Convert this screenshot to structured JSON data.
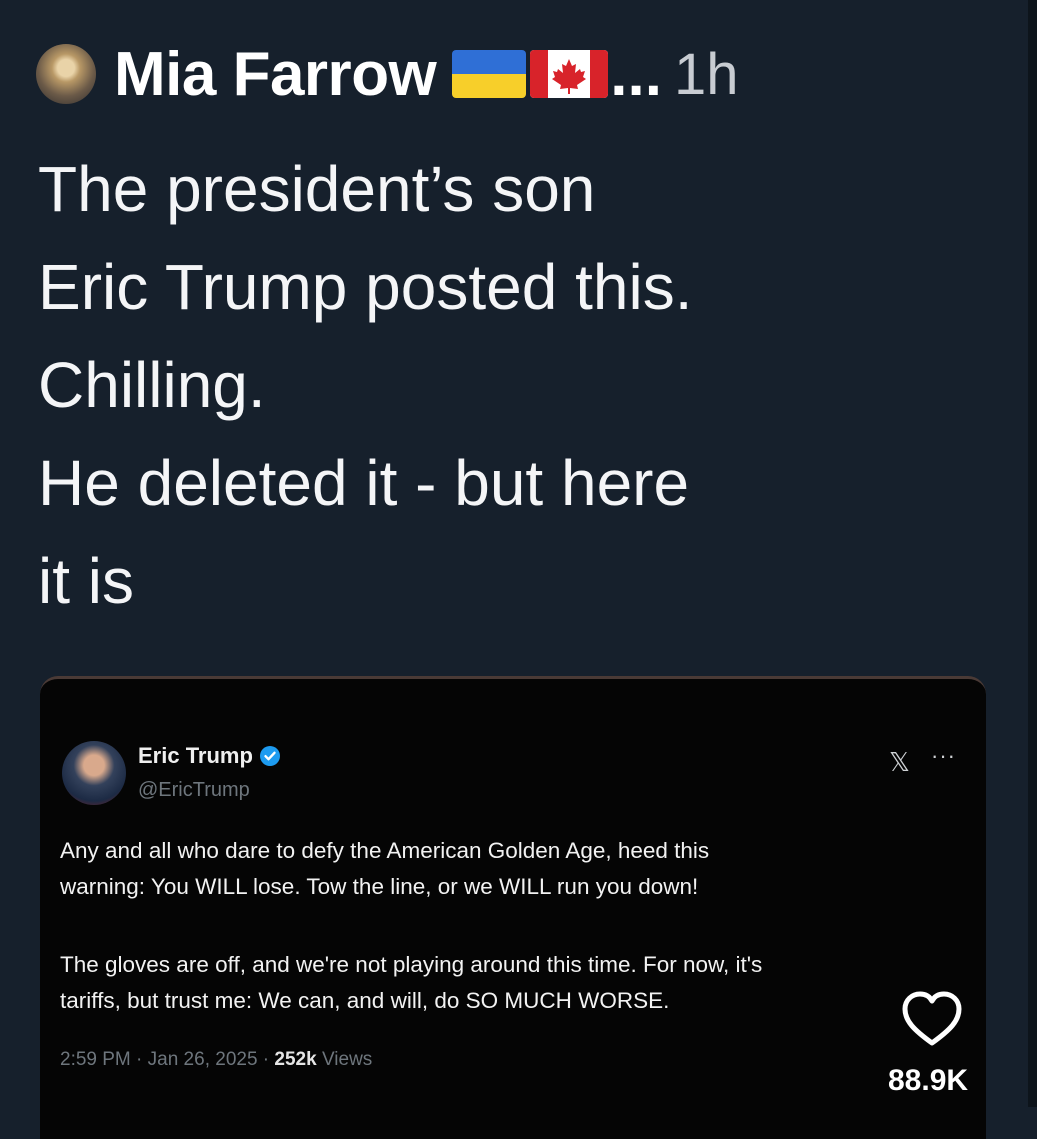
{
  "author": {
    "name": "Mia Farrow",
    "ellipsis": "...",
    "time": "1h"
  },
  "tweet": {
    "lines": [
      "The president’s son",
      "Eric Trump posted this.",
      "Chilling.",
      "He deleted it - but here",
      "it is"
    ]
  },
  "embedded_post": {
    "name": "Eric Trump",
    "handle": "@EricTrump",
    "paragraph1_line1": "Any and all who dare to defy the American Golden Age, heed this",
    "paragraph1_line2": "warning: You WILL lose. Tow the line, or we WILL run you down!",
    "paragraph2_line1": "The gloves are off, and we're not playing around this time. For now, it's",
    "paragraph2_line2": "tariffs, but trust me: We can, and will, do SO MUCH WORSE.",
    "timestamp": "2:59 PM · Jan 26, 2025 · ",
    "views_count": "252k",
    "views_label": " Views",
    "x_icon": "x-logo-icon",
    "more": "···"
  },
  "likes": {
    "count": "88.9K"
  },
  "colors": {
    "background": "#16202c",
    "embed_background": "#050505",
    "verified": "#1d9bf0",
    "muted": "#6e767d"
  }
}
